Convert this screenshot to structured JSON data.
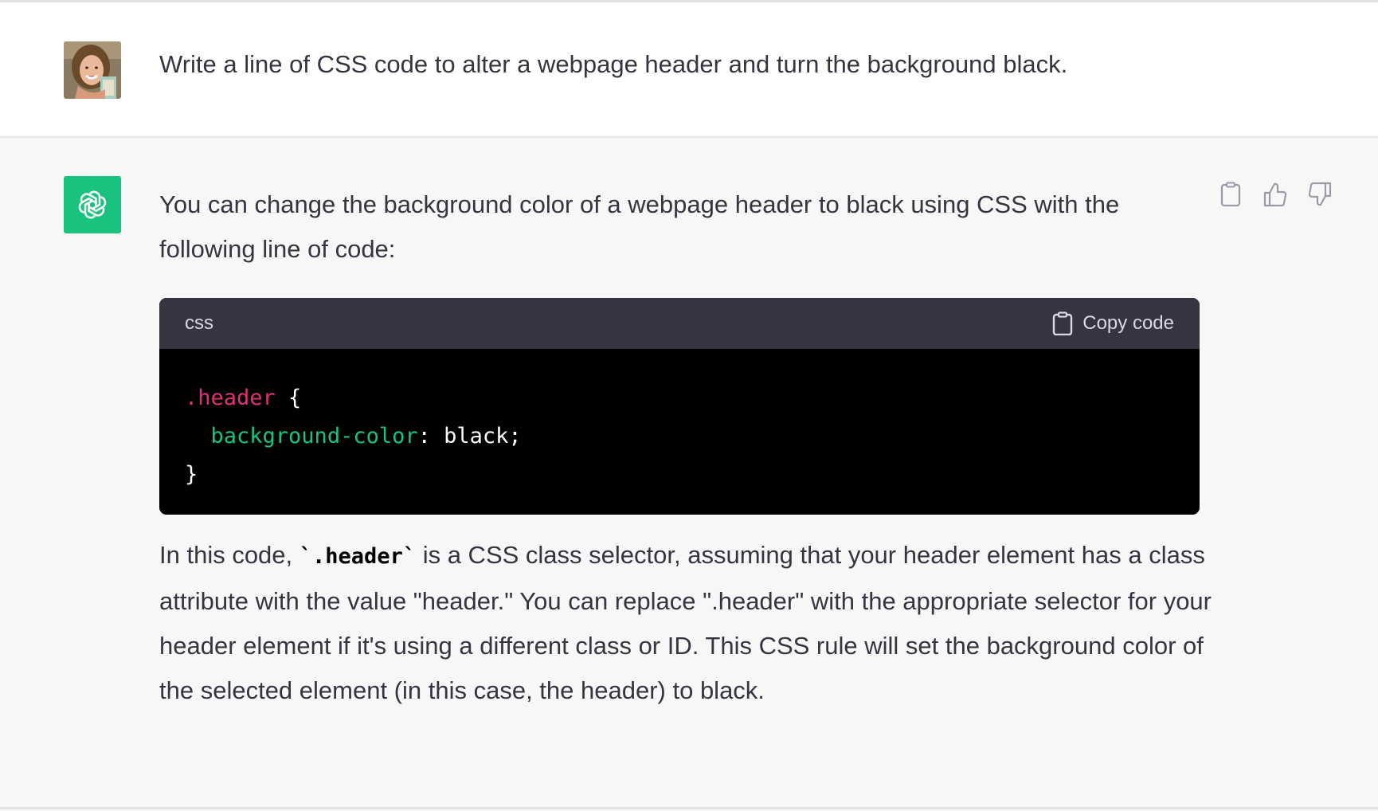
{
  "user_message": {
    "text": "Write a line of CSS code to alter a webpage header and turn the background black.",
    "avatar_icon": "user-avatar-photo"
  },
  "assistant_message": {
    "logo_icon": "openai-logo-icon",
    "intro": "You can change the background color of a webpage header to black using CSS with the following line of code:",
    "code_block": {
      "language": "css",
      "copy_label": "Copy code",
      "copy_icon": "clipboard-icon",
      "lines": [
        {
          "selector": ".header",
          "rest": " {"
        },
        {
          "indent": "  ",
          "property": "background-color",
          "colon": ": ",
          "value": "black;"
        },
        {
          "close": "}"
        }
      ]
    },
    "explanation": {
      "before": "In this code, ",
      "code": "`.header`",
      "after": " is a CSS class selector, assuming that your header element has a class attribute with the value \"header.\" You can replace \".header\" with the appropriate selector for your header element if it's using a different class or ID. This CSS rule will set the background color of the selected element (in this case, the header) to black."
    },
    "actions": {
      "copy_icon": "clipboard-icon",
      "thumbs_up_icon": "thumbs-up-icon",
      "thumbs_down_icon": "thumbs-down-icon"
    }
  },
  "colors": {
    "accent": "#19c37d",
    "selector": "#df3079",
    "code_header": "#343541",
    "code_bg": "#000000"
  }
}
